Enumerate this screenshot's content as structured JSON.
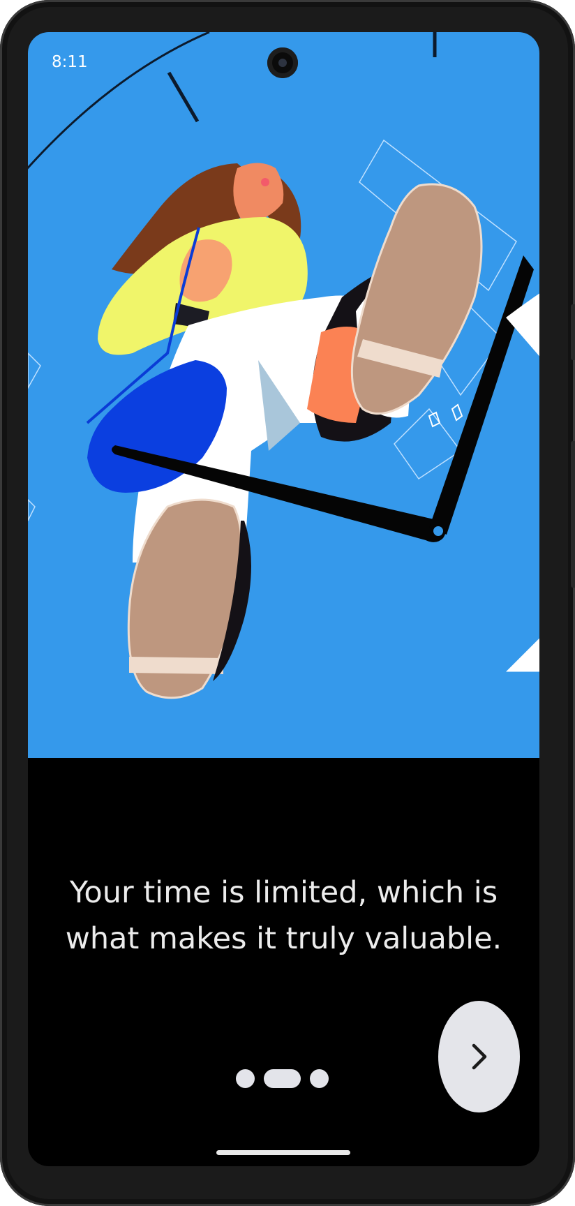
{
  "status_bar": {
    "time": "8:11",
    "icons": [
      "wifi-icon",
      "cellular-signal-icon",
      "battery-icon"
    ]
  },
  "illustration": {
    "subject": "woman-on-clock-hands",
    "background_color": "#3599eb"
  },
  "onboarding": {
    "headline_line1": "Your time is limited, which is",
    "headline_line2": "what makes it truly valuable.",
    "pager": {
      "total_pages": 3,
      "current_page": 2
    },
    "next_button_icon": "chevron-right-icon"
  },
  "colors": {
    "screen_background": "#000000",
    "text": "#ececec",
    "button": "#e4e5ea"
  }
}
